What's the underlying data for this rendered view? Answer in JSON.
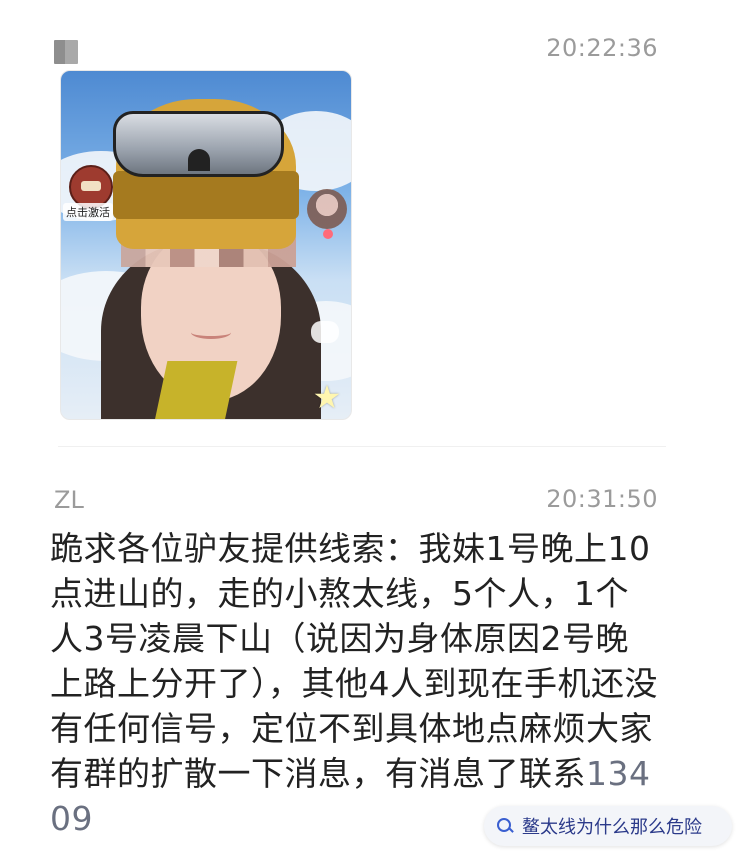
{
  "message1": {
    "time": "20:22:36",
    "image_badge_label": "点击激活"
  },
  "message2": {
    "sender": "ZL",
    "time": "20:31:50",
    "text": "跪求各位驴友提供线索：我妹1号晚上10点进山的，走的小熬太线，5个人，1个人3号凌晨下山（说因为身体原因2号晚上路上分开了），其他4人到现在手机还没有任何信号，定位不到具体地点麻烦大家有群的扩散一下消息，有消息了联系",
    "phone_partial": "13409"
  },
  "search_suggestion": {
    "icon": "search-icon",
    "label": "鳌太线为什么那么危险"
  }
}
